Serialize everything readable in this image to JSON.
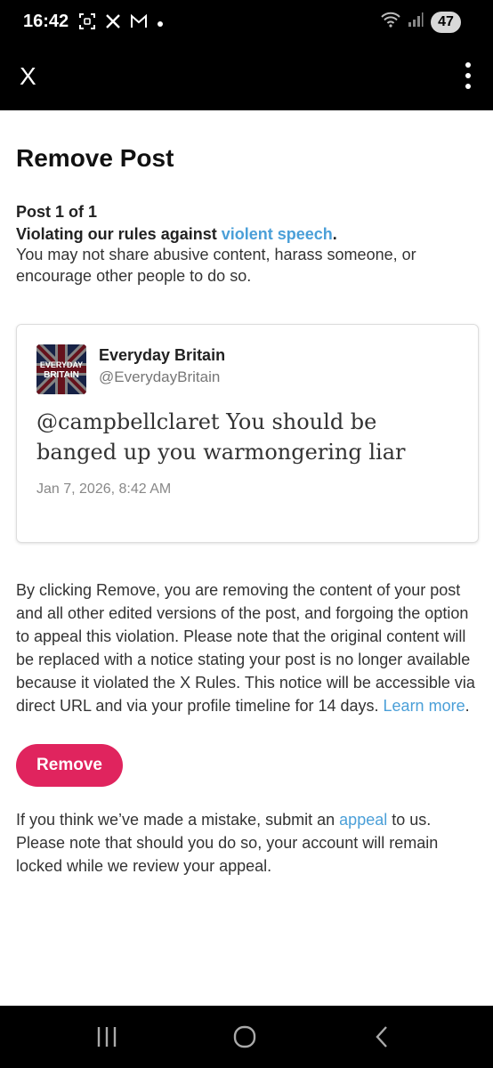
{
  "status_bar": {
    "time": "16:42",
    "battery": "47",
    "icons": [
      "screenshot-icon",
      "x-notification-icon",
      "gmail-icon",
      "dot-icon",
      "wifi-icon",
      "signal-icon"
    ]
  },
  "app_bar": {
    "close_label": "X",
    "menu_icon": "more-vert-icon"
  },
  "page": {
    "title": "Remove Post",
    "post_count": "Post 1 of 1",
    "rule_prefix": "Violating our rules against ",
    "rule_link": "violent speech",
    "rule_suffix": ".",
    "rule_description": "You may not share abusive content, harass someone, or encourage other people to do so."
  },
  "tweet": {
    "avatar_text_line1": "EVERYDAY",
    "avatar_text_line2": "BRITAIN",
    "author_name": "Everyday Britain",
    "author_handle": "@EverydayBritain",
    "text": "@campbellclaret You should be banged up you warmongering liar",
    "date": "Jan 7, 2026, 8:42 AM"
  },
  "notice": {
    "text": "By clicking Remove, you are removing the content of your post and all other edited versions of the post, and forgoing the option to appeal this violation. Please note that the original content will be replaced with a notice stating your post is no longer available because it violated the X Rules. This notice will be accessible via direct URL and via your profile timeline for 14 days. ",
    "learn_more": "Learn more",
    "end": "."
  },
  "remove_button": "Remove",
  "appeal": {
    "prefix": "If you think we’ve made a mistake, submit an ",
    "link": "appeal",
    "suffix": " to us. Please note that should you do so, your account will remain locked while we review your appeal."
  },
  "colors": {
    "link": "#4a9fd8",
    "remove_button": "#e0245e",
    "bars": "#000000"
  }
}
